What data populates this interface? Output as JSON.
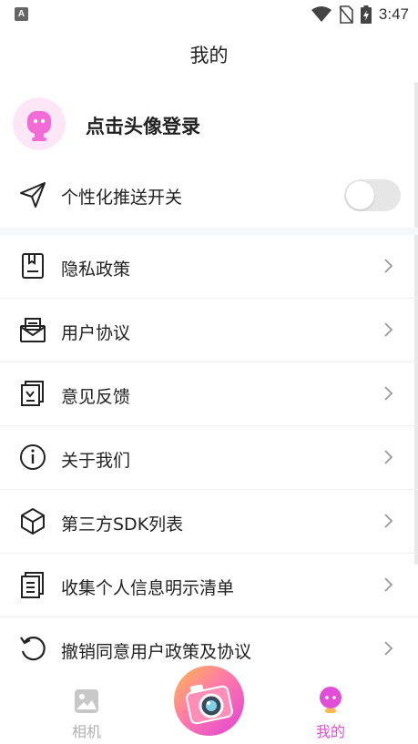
{
  "status_bar": {
    "time": "3:47",
    "notification_badge": "A"
  },
  "header": {
    "title": "我的"
  },
  "profile": {
    "login_label": "点击头像登录"
  },
  "push_setting": {
    "label": "个性化推送开关",
    "enabled": false
  },
  "menu": [
    {
      "label": "隐私政策",
      "icon": "privacy-doc-icon"
    },
    {
      "label": "用户协议",
      "icon": "mail-agreement-icon"
    },
    {
      "label": "意见反馈",
      "icon": "feedback-icon"
    },
    {
      "label": "关于我们",
      "icon": "info-icon"
    },
    {
      "label": "第三方SDK列表",
      "icon": "cube-icon"
    },
    {
      "label": "收集个人信息明示清单",
      "icon": "document-list-icon"
    },
    {
      "label": "撤销同意用户政策及协议",
      "icon": "undo-icon"
    }
  ],
  "tabbar": {
    "camera_label": "相机",
    "me_label": "我的"
  },
  "colors": {
    "accent": "#e04fd6",
    "avatar_bg": "#fde7f7",
    "toggle_off": "#e6e6e6"
  }
}
